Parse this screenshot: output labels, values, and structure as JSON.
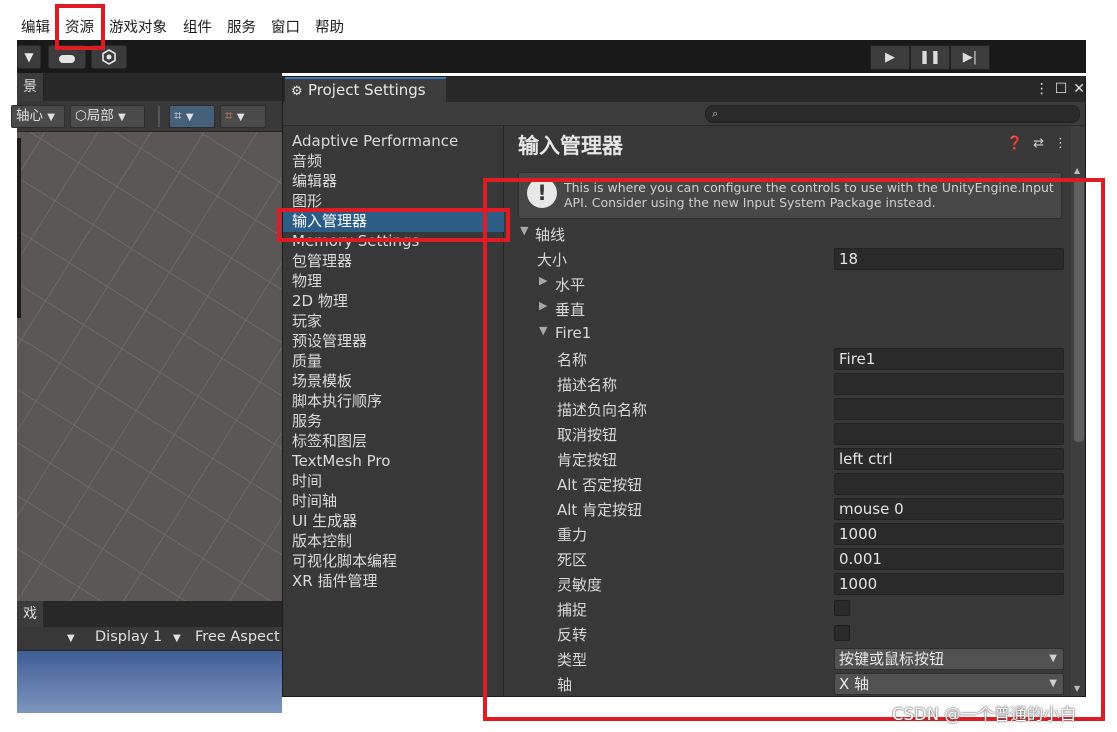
{
  "menubar": {
    "items": [
      "编辑",
      "资源",
      "游戏对象",
      "组件",
      "服务",
      "窗口",
      "帮助"
    ]
  },
  "scene": {
    "tab_label": "景",
    "pivot_label": "轴心",
    "local_label": "局部"
  },
  "game": {
    "tab_label": "戏",
    "display_label": "Display 1",
    "aspect_label": "Free Aspect"
  },
  "project_settings": {
    "window_title": "Project Settings",
    "search_placeholder": "",
    "nav": [
      "Adaptive Performance",
      "音频",
      "编辑器",
      "图形",
      "输入管理器",
      "Memory Settings",
      "包管理器",
      "物理",
      "2D 物理",
      "玩家",
      "预设管理器",
      "质量",
      "场景模板",
      "脚本执行顺序",
      "服务",
      "标签和图层",
      "TextMesh Pro",
      "时间",
      "时间轴",
      "UI 生成器",
      "版本控制",
      "可视化脚本编程",
      "XR 插件管理"
    ],
    "selected_index": 4,
    "title": "输入管理器",
    "help_text": "This is where you can configure the controls to use with the UnityEngine.Input API. Consider using the new Input System Package instead.",
    "axes_label": "轴线",
    "size_label": "大小",
    "size_value": "18",
    "horizontal_label": "水平",
    "vertical_label": "垂直",
    "fire1": {
      "header": "Fire1",
      "rows": [
        {
          "label": "名称",
          "kind": "text",
          "value": "Fire1"
        },
        {
          "label": "描述名称",
          "kind": "text",
          "value": ""
        },
        {
          "label": "描述负向名称",
          "kind": "text",
          "value": ""
        },
        {
          "label": "取消按钮",
          "kind": "text",
          "value": ""
        },
        {
          "label": "肯定按钮",
          "kind": "text",
          "value": "left ctrl"
        },
        {
          "label": "Alt 否定按钮",
          "kind": "text",
          "value": ""
        },
        {
          "label": "Alt 肯定按钮",
          "kind": "text",
          "value": "mouse 0"
        },
        {
          "label": "重力",
          "kind": "text",
          "value": "1000"
        },
        {
          "label": "死区",
          "kind": "text",
          "value": "0.001"
        },
        {
          "label": "灵敏度",
          "kind": "text",
          "value": "1000"
        },
        {
          "label": "捕捉",
          "kind": "checkbox",
          "value": ""
        },
        {
          "label": "反转",
          "kind": "checkbox",
          "value": ""
        },
        {
          "label": "类型",
          "kind": "dropdown",
          "value": "按键或鼠标按钮"
        },
        {
          "label": "轴",
          "kind": "dropdown",
          "value": "X 轴"
        }
      ]
    }
  },
  "watermark": "CSDN @一个普通的小白",
  "colors": {
    "highlight_red": "#e11b23",
    "selection_blue": "#2c5d87",
    "panel_bg": "#383838"
  }
}
